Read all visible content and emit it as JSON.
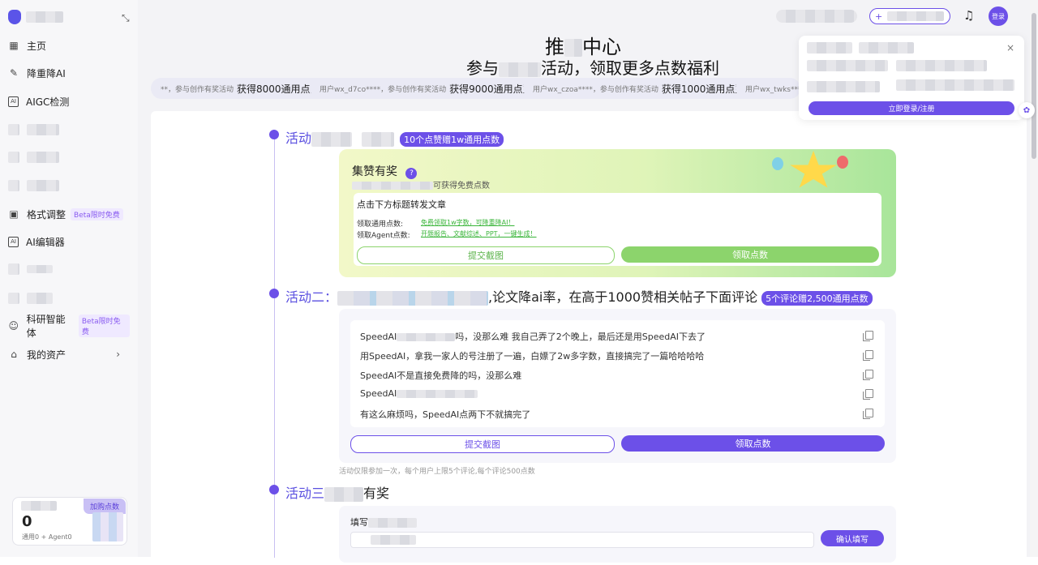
{
  "sidebar": {
    "items": [
      {
        "label": "主页",
        "icon": "grid-icon"
      },
      {
        "label": "降重降AI",
        "icon": "pen-icon"
      },
      {
        "label": "AIGC检测",
        "icon": "ai-scan-icon"
      },
      {
        "label": "格式调整",
        "icon": "briefcase-icon",
        "beta": "Beta限时免费"
      },
      {
        "label": "AI编辑器",
        "icon": "ai-editor-icon"
      },
      {
        "label": "科研智能体",
        "icon": "robot-icon",
        "beta": "Beta限时免费"
      },
      {
        "label": "我的资产",
        "icon": "home-icon"
      }
    ],
    "points": {
      "value": "0",
      "sub": "通用0 + Agent0",
      "buy": "加购点数"
    }
  },
  "header": {
    "login": "登录",
    "title1_a": "推",
    "title1_b": "中心",
    "title2_a": "参与",
    "title2_b": "活动，领取更多点数福利"
  },
  "ticker": [
    {
      "text": "**，参与创作有奖活动",
      "reward": "获得8000通用点数"
    },
    {
      "text": "用户wx_d7co****，参与创作有奖活动",
      "reward": "获得9000通用点数"
    },
    {
      "text": "用户wx_czoa****，参与创作有奖活动",
      "reward": "获得1000通用点数"
    },
    {
      "text": "用户wx_twks****，",
      "reward": ""
    }
  ],
  "popup": {
    "login_button": "立即登录/注册"
  },
  "activity1": {
    "title": "活动",
    "badge": "10个点赞赠1w通用点数",
    "card_title": "集赞有奖",
    "card_sub": "可获得免费点数",
    "inner_title": "点击下方标题转发文章",
    "row1_label": "领取通用点数:",
    "row1_link": "免费领取1w字数，可降重降AI！",
    "row2_label": "领取Agent点数:",
    "row2_link": "开题报告、文献综述、PPT，一键生成！",
    "submit": "提交截图",
    "claim": "领取点数"
  },
  "activity2": {
    "title": "活动二：",
    "title_tail": ",论文降ai率，在高于1000赞相关帖子下面评论",
    "link_text": "论文降ai率",
    "badge": "5个评论赠2,500通用点数",
    "comments": [
      "SpeedAI",
      "用SpeedAI，拿我一家人的号注册了一遍，白嫖了2w多字数，直接搞完了一篇哈哈哈哈",
      "SpeedAI不是直接免费降的吗，没那么难",
      "SpeedAI",
      "有这么麻烦吗，SpeedAI点两下不就搞完了"
    ],
    "comment1_tail": "吗，没那么难 我自己弄了2个晚上，最后还是用SpeedAI下去了",
    "submit": "提交截图",
    "claim": "领取点数",
    "note": "活动仅限参加一次，每个用户上限5个评论,每个评论500点数"
  },
  "activity3": {
    "title": "活动三",
    "title_tail": "有奖",
    "fill_label": "填写",
    "confirm": "确认填写"
  },
  "colors": {
    "accent": "#6c50e8",
    "green": "#8cd46c"
  }
}
